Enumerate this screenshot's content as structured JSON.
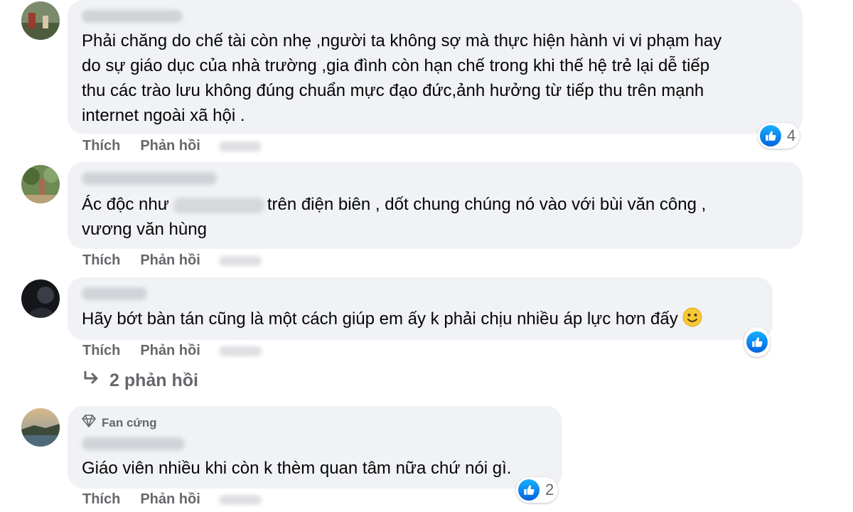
{
  "comments": [
    {
      "text": "Phải chăng do chế tài còn nhẹ ,người ta không sợ mà thực hiện hành vi vi phạm hay\ndo sự giáo dục của nhà trường ,gia đình còn hạn chế trong khi thế hệ trẻ lại dễ tiếp\nthu các trào lưu không đúng chuẩn mực đạo đức,ảnh hưởng từ tiếp thu trên mạnh\ninternet ngoài xã hội .",
      "like_label": "Thích",
      "reply_label": "Phản hồi",
      "reaction_count": "4"
    },
    {
      "text_before": "Ác độc như",
      "text_after": "trên điện biên , dốt chung chúng nó vào với bùi văn công ,",
      "text_line2": "vương văn hùng",
      "like_label": "Thích",
      "reply_label": "Phản hồi"
    },
    {
      "text": "Hãy bớt bàn tán cũng là một cách giúp em ấy k phải chịu nhiều áp lực hơn đấy",
      "like_label": "Thích",
      "reply_label": "Phản hồi",
      "replies_label": "2 phản hồi"
    },
    {
      "badge": "Fan cứng",
      "text": "Giáo viên nhiều khi còn k thèm quan tâm nữa chứ nói gì.",
      "like_label": "Thích",
      "reply_label": "Phản hồi",
      "reaction_count": "2"
    }
  ],
  "colors": {
    "bubble": "#f0f2f5",
    "secondary_text": "#65676b",
    "like_blue": "#1877f2"
  },
  "icons": [
    "like-icon",
    "reply-arrow-icon",
    "diamond-icon",
    "smiley-emoji"
  ]
}
